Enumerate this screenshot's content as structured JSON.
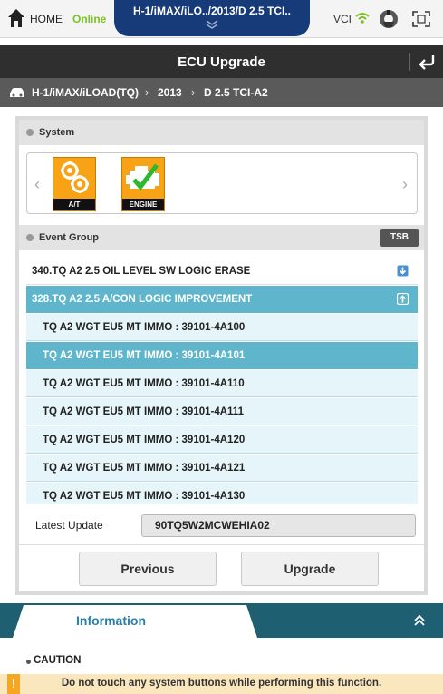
{
  "topbar": {
    "home_label": "HOME",
    "status": "Online",
    "vehicle_tab": "H-1/iMAX/iLO../2013/D 2.5 TCI..",
    "vci_label": "VCI",
    "status_color": "#7cc221"
  },
  "title": "ECU Upgrade",
  "breadcrumb": {
    "items": [
      "H-1/iMAX/iLOAD(TQ)",
      "2013",
      "D 2.5 TCI-A2"
    ],
    "separator": "›"
  },
  "system": {
    "title": "System",
    "tiles": [
      {
        "label": "A/T",
        "icon": "gears-icon"
      },
      {
        "label": "ENGINE",
        "icon": "engine-check-icon"
      }
    ]
  },
  "event_group": {
    "title": "Event Group",
    "tsb_label": "TSB",
    "rows": [
      {
        "text": "340.TQ A2 2.5 OIL LEVEL SW LOGIC ERASE",
        "kind": "group",
        "icon": "expand-down-icon"
      },
      {
        "text": "328.TQ A2 2.5 A/CON LOGIC IMPROVEMENT",
        "kind": "group-open",
        "icon": "collapse-up-icon"
      },
      {
        "text": "TQ A2 WGT EU5 MT IMMO : 39101-4A100",
        "kind": "sub"
      },
      {
        "text": "TQ A2 WGT EU5 MT IMMO : 39101-4A101",
        "kind": "sub-selected"
      },
      {
        "text": "TQ A2 WGT EU5 MT IMMO : 39101-4A110",
        "kind": "sub"
      },
      {
        "text": "TQ A2 WGT EU5 MT IMMO : 39101-4A111",
        "kind": "sub"
      },
      {
        "text": "TQ A2 WGT EU5 MT IMMO : 39101-4A120",
        "kind": "sub"
      },
      {
        "text": "TQ A2 WGT EU5 MT IMMO : 39101-4A121",
        "kind": "sub"
      },
      {
        "text": "TQ A2 WGT EU5 MT IMMO : 39101-4A130",
        "kind": "sub"
      }
    ]
  },
  "latest_update": {
    "label": "Latest Update",
    "value": "90TQ5W2MCWEHIA02"
  },
  "buttons": {
    "previous": "Previous",
    "upgrade": "Upgrade"
  },
  "information": {
    "tab_label": "Information",
    "caution_title": "CAUTION",
    "caution_text": "Do not touch any system buttons while performing this function.",
    "caution_mark": "!"
  },
  "colors": {
    "accent": "#5fb5cc",
    "title_bar": "#2f2f2f",
    "vehicle_tab": "#173a78",
    "info_band": "#1f5f72",
    "tile": "#f7a315"
  }
}
